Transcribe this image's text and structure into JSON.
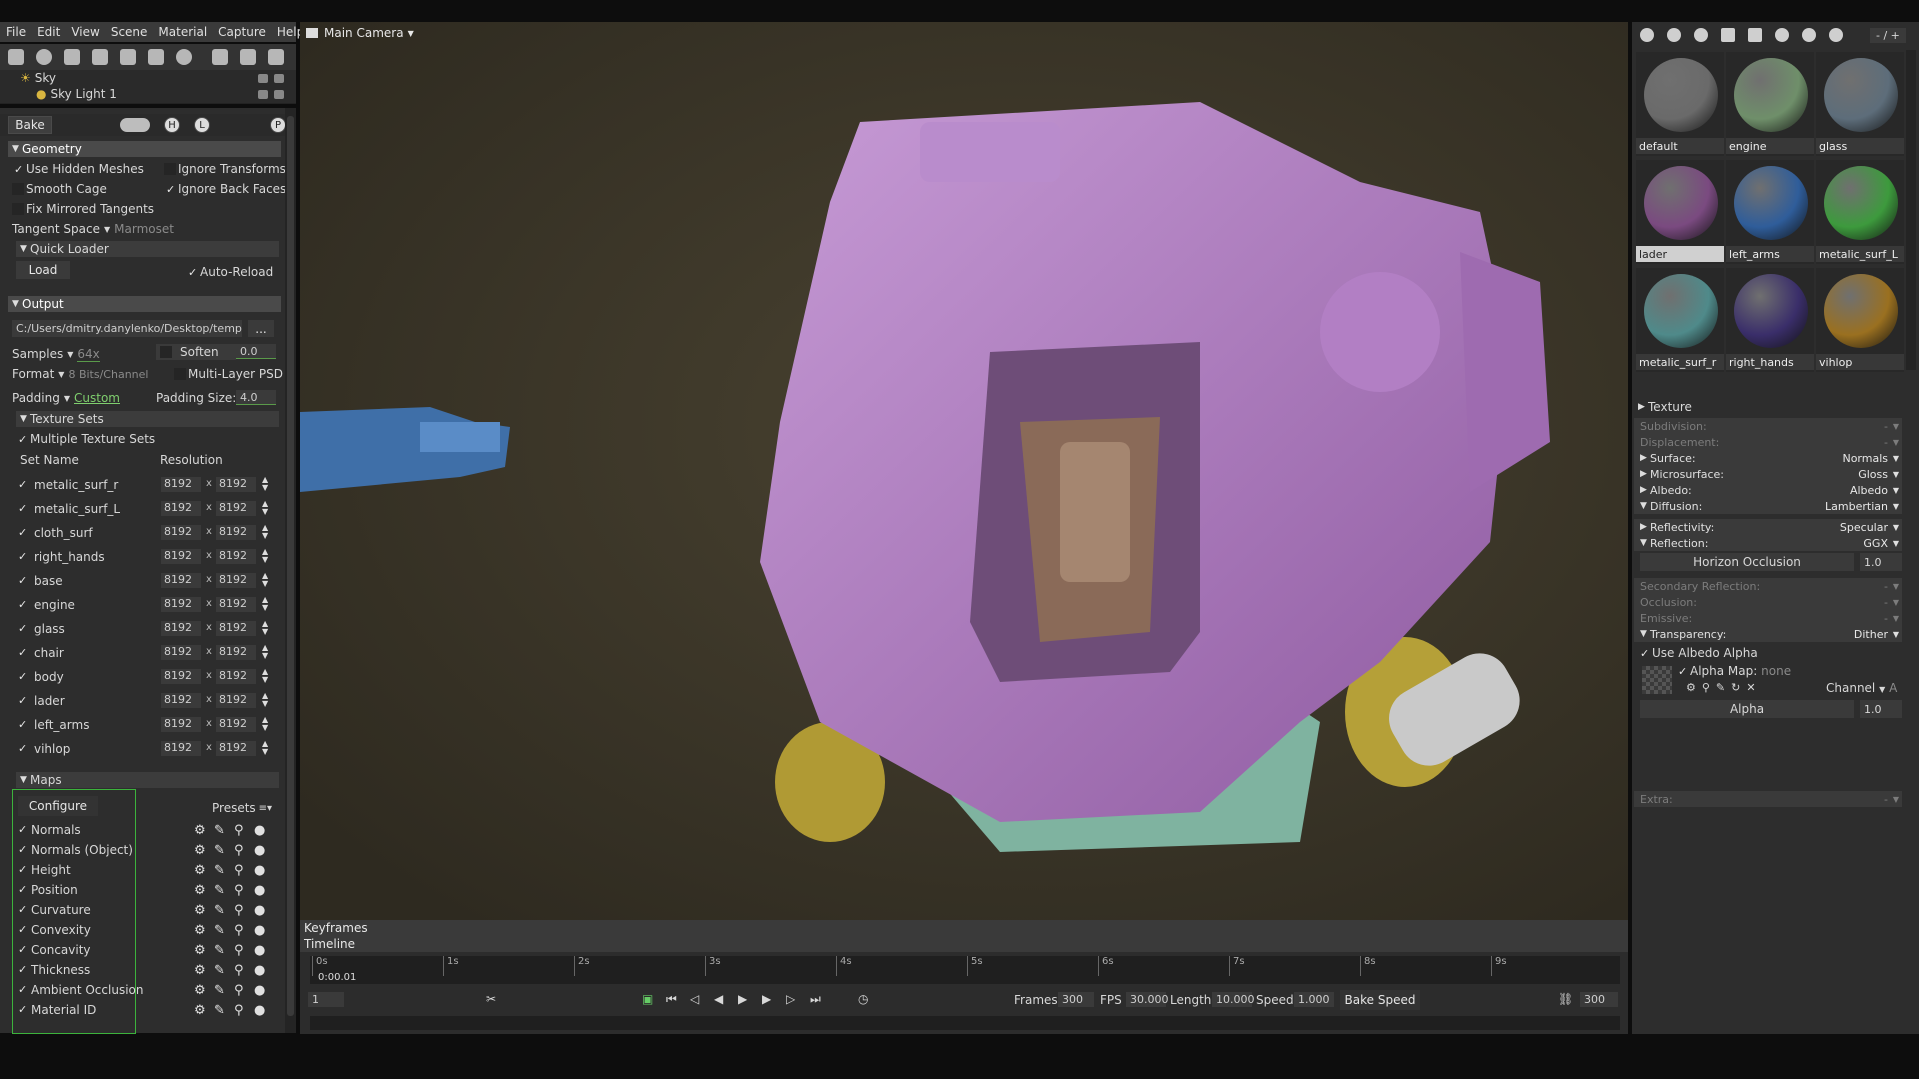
{
  "menu": [
    "File",
    "Edit",
    "View",
    "Scene",
    "Material",
    "Capture",
    "Help"
  ],
  "scene_tree": [
    {
      "label": "Sky"
    },
    {
      "label": "Sky Light 1"
    }
  ],
  "bake": {
    "bake_button": "Bake",
    "h_button": "H",
    "l_button": "L",
    "p_button": "P",
    "geometry": {
      "title": "Geometry",
      "use_hidden_meshes": "Use Hidden Meshes",
      "ignore_transforms": "Ignore Transforms",
      "smooth_cage": "Smooth Cage",
      "ignore_back_faces": "Ignore Back Faces",
      "fix_mirrored": "Fix Mirrored Tangents",
      "tangent_space_label": "Tangent Space",
      "tangent_space_value": "Marmoset",
      "quick_loader": "Quick Loader",
      "load": "Load",
      "auto_reload": "Auto-Reload"
    },
    "output": {
      "title": "Output",
      "path": "C:/Users/dmitry.danylenko/Desktop/temp",
      "browse": "...",
      "samples_label": "Samples",
      "samples_value": "64x",
      "soften": "Soften",
      "soften_value": "0.0",
      "format_label": "Format",
      "format_value": "8 Bits/Channel",
      "multilayer": "Multi-Layer PSD",
      "padding_label": "Padding",
      "padding_value": "Custom",
      "padding_size_label": "Padding Size:",
      "padding_size_value": "4.0"
    },
    "texture_sets": {
      "title": "Texture Sets",
      "multiple": "Multiple Texture Sets",
      "col_name": "Set Name",
      "col_res": "Resolution",
      "rows": [
        {
          "name": "metalic_surf_r",
          "w": "8192",
          "h": "8192"
        },
        {
          "name": "metalic_surf_L",
          "w": "8192",
          "h": "8192"
        },
        {
          "name": "cloth_surf",
          "w": "8192",
          "h": "8192"
        },
        {
          "name": "right_hands",
          "w": "8192",
          "h": "8192"
        },
        {
          "name": "base",
          "w": "8192",
          "h": "8192"
        },
        {
          "name": "engine",
          "w": "8192",
          "h": "8192"
        },
        {
          "name": "glass",
          "w": "8192",
          "h": "8192"
        },
        {
          "name": "chair",
          "w": "8192",
          "h": "8192"
        },
        {
          "name": "body",
          "w": "8192",
          "h": "8192"
        },
        {
          "name": "lader",
          "w": "8192",
          "h": "8192"
        },
        {
          "name": "left_arms",
          "w": "8192",
          "h": "8192"
        },
        {
          "name": "vihlop",
          "w": "8192",
          "h": "8192"
        }
      ]
    },
    "maps": {
      "title": "Maps",
      "configure": "Configure",
      "presets": "Presets",
      "rows": [
        "Normals",
        "Normals (Object)",
        "Height",
        "Position",
        "Curvature",
        "Convexity",
        "Concavity",
        "Thickness",
        "Ambient Occlusion",
        "Material ID"
      ]
    }
  },
  "viewport": {
    "camera": "Main Camera"
  },
  "timeline": {
    "keyframes": "Keyframes",
    "timeline": "Timeline",
    "ticks": [
      "0s",
      "1s",
      "2s",
      "3s",
      "4s",
      "5s",
      "6s",
      "7s",
      "8s",
      "9s"
    ],
    "current_time": "0:00.01",
    "frame": "1",
    "frames_label": "Frames",
    "frames_value": "300",
    "fps_label": "FPS",
    "fps_value": "30.000",
    "length_label": "Length",
    "length_value": "10.000",
    "speed_label": "Speed",
    "speed_value": "1.000",
    "bake_speed": "Bake Speed",
    "end_frame": "300"
  },
  "materials": {
    "counter": "- / +",
    "items": [
      {
        "name": "default",
        "color": "#6a6a6a",
        "selected": false
      },
      {
        "name": "engine",
        "color": "#6f8f6a",
        "selected": false
      },
      {
        "name": "glass",
        "color": "#5d6d7a",
        "selected": false
      },
      {
        "name": "lader",
        "color": "#7a4a80",
        "selected": true
      },
      {
        "name": "left_arms",
        "color": "#2f5d9a",
        "selected": false
      },
      {
        "name": "metalic_surf_L",
        "color": "#3d9a3d",
        "selected": false
      },
      {
        "name": "metalic_surf_r",
        "color": "#4f8a8a",
        "selected": false
      },
      {
        "name": "right_hands",
        "color": "#3a2e6a",
        "selected": false
      },
      {
        "name": "vihlop",
        "color": "#9a7020",
        "selected": false
      }
    ]
  },
  "properties": {
    "texture": "Texture",
    "subdivision": {
      "label": "Subdivision:",
      "value": "-"
    },
    "displacement": {
      "label": "Displacement:",
      "value": "-"
    },
    "surface": {
      "label": "Surface:",
      "value": "Normals"
    },
    "microsurface": {
      "label": "Microsurface:",
      "value": "Gloss"
    },
    "albedo": {
      "label": "Albedo:",
      "value": "Albedo"
    },
    "diffusion": {
      "label": "Diffusion:",
      "value": "Lambertian"
    },
    "reflectivity": {
      "label": "Reflectivity:",
      "value": "Specular"
    },
    "reflection": {
      "label": "Reflection:",
      "value": "GGX"
    },
    "horizon_occlusion": {
      "label": "Horizon Occlusion",
      "value": "1.0"
    },
    "secondary_reflection": {
      "label": "Secondary Reflection:",
      "value": "-"
    },
    "occlusion": {
      "label": "Occlusion:",
      "value": "-"
    },
    "emissive": {
      "label": "Emissive:",
      "value": "-"
    },
    "transparency": {
      "label": "Transparency:",
      "value": "Dither"
    },
    "use_albedo_alpha": "Use Albedo Alpha",
    "alpha_map_label": "Alpha Map:",
    "alpha_map_value": "none",
    "channel_label": "Channel",
    "channel_value": "A",
    "alpha_label": "Alpha",
    "alpha_value": "1.0",
    "extra": {
      "label": "Extra:",
      "value": "-"
    }
  }
}
